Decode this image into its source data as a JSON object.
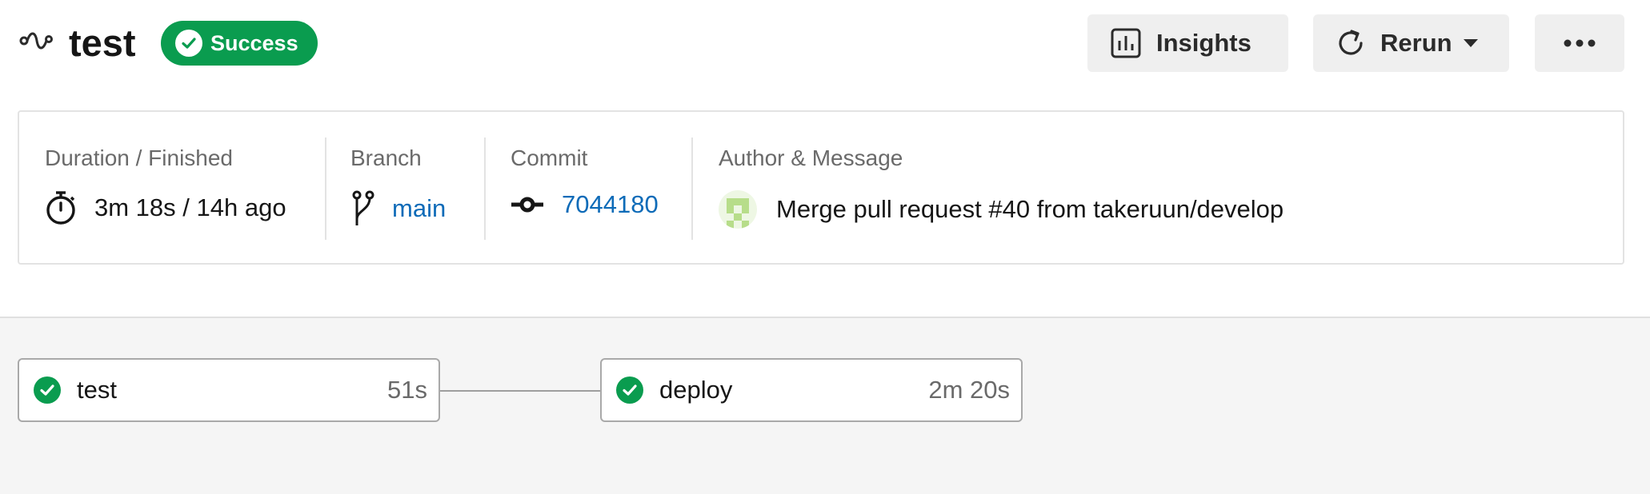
{
  "workflow": {
    "name": "test",
    "status": "Success",
    "status_color": "#0a9c4f"
  },
  "toolbar": {
    "insights_label": "Insights",
    "rerun_label": "Rerun",
    "more_icon": "more-horizontal-icon"
  },
  "info": {
    "duration": {
      "label": "Duration / Finished",
      "value": "3m 18s / 14h ago",
      "icon": "stopwatch-icon"
    },
    "branch": {
      "label": "Branch",
      "value": "main",
      "icon": "git-branch-icon"
    },
    "commit": {
      "label": "Commit",
      "value": "7044180",
      "icon": "git-commit-icon"
    },
    "author": {
      "label": "Author & Message",
      "message": "Merge pull request #40 from takeruun/develop",
      "icon": "avatar"
    }
  },
  "jobs": [
    {
      "name": "test",
      "duration": "51s",
      "status": "success"
    },
    {
      "name": "deploy",
      "duration": "2m 20s",
      "status": "success"
    }
  ],
  "colors": {
    "success": "#0a9c4f",
    "link": "#0e6bb8",
    "button_bg": "#efefef"
  }
}
